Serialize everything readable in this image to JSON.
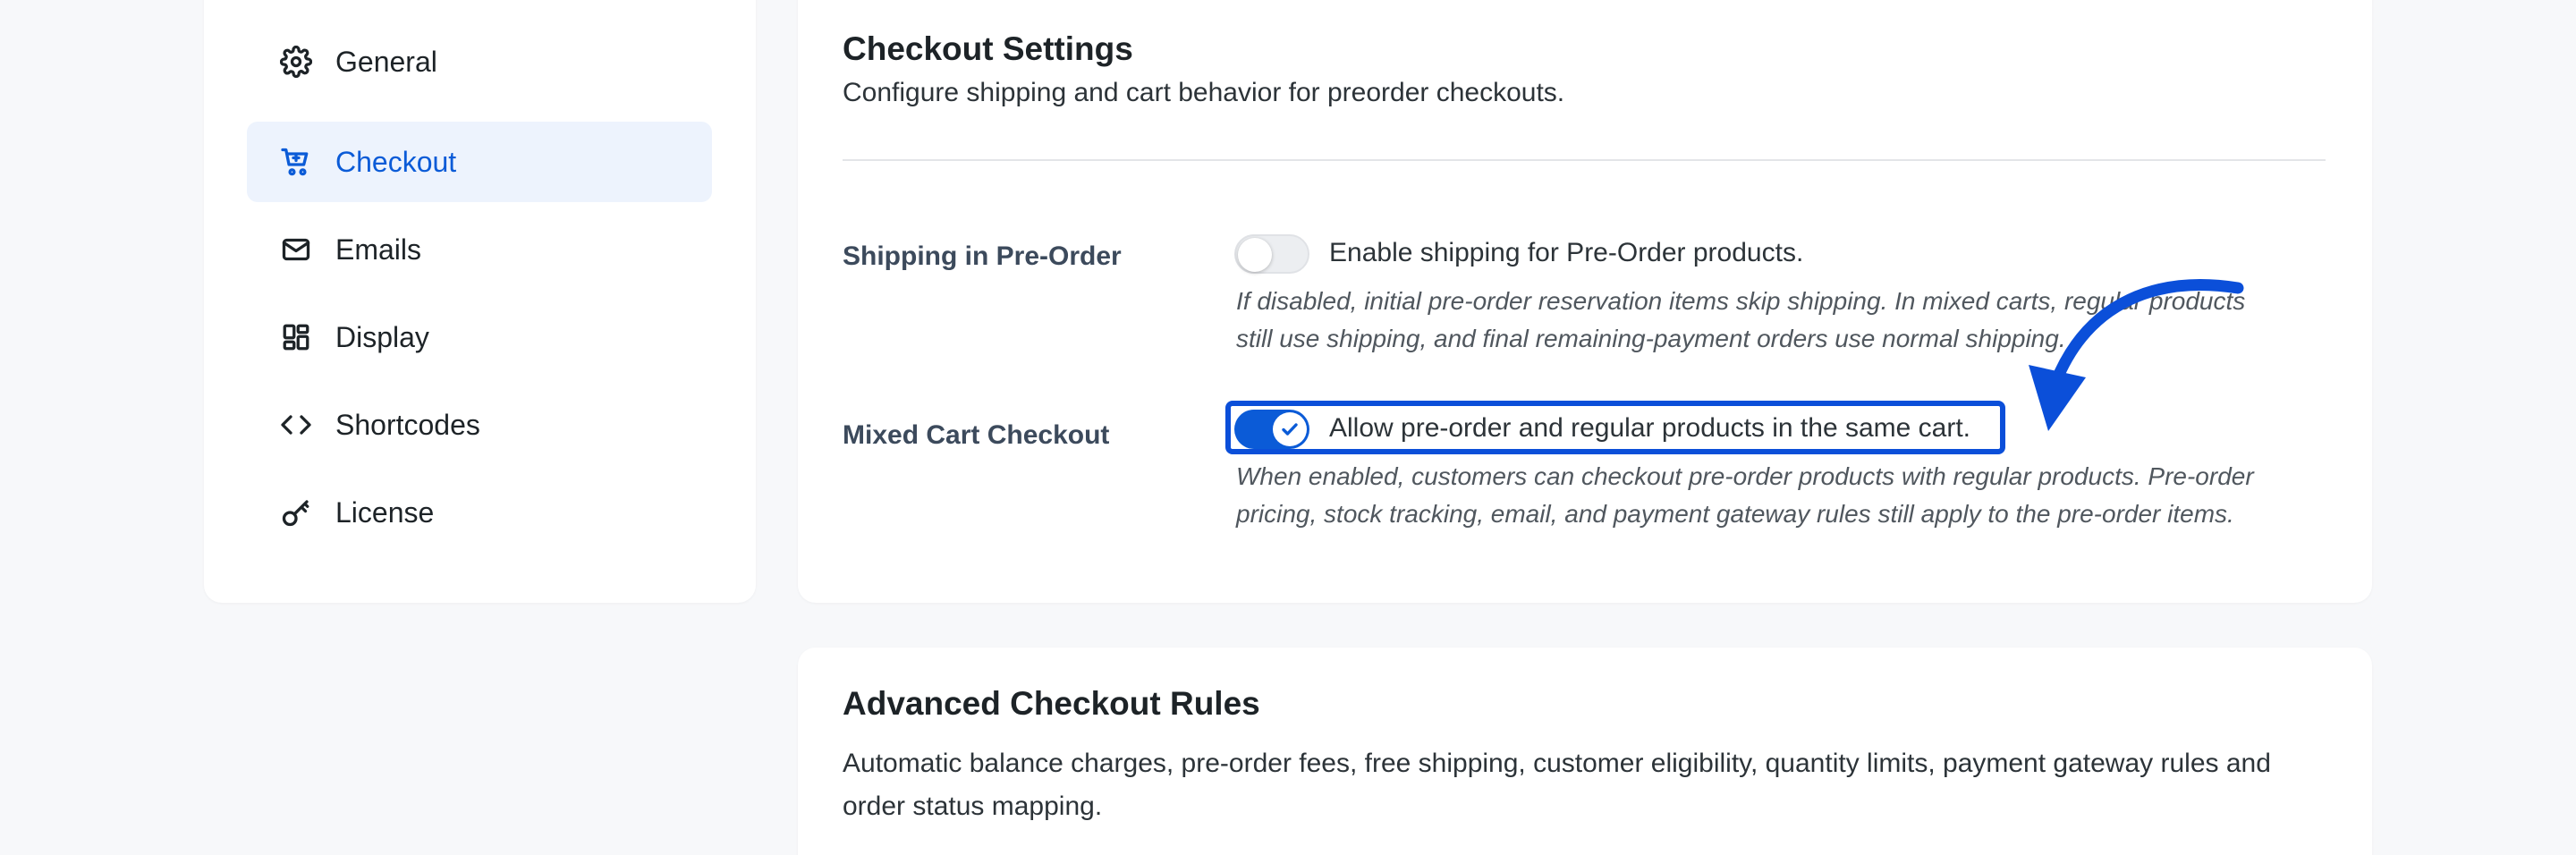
{
  "sidebar": {
    "items": [
      {
        "label": "General",
        "icon": "gear-icon"
      },
      {
        "label": "Checkout",
        "icon": "cart-icon",
        "active": true
      },
      {
        "label": "Emails",
        "icon": "mail-icon"
      },
      {
        "label": "Display",
        "icon": "dashboard-icon"
      },
      {
        "label": "Shortcodes",
        "icon": "code-icon"
      },
      {
        "label": "License",
        "icon": "key-icon"
      }
    ]
  },
  "checkout": {
    "title": "Checkout Settings",
    "description": "Configure shipping and cart behavior for preorder checkouts.",
    "shipping": {
      "label": "Shipping in Pre-Order",
      "toggle_text": "Enable shipping for Pre-Order products.",
      "enabled": false,
      "help_line1": "If disabled, initial pre-order reservation items skip shipping. In mixed carts, regular products",
      "help_line2": "still use shipping, and final remaining-payment orders use normal shipping."
    },
    "mixed_cart": {
      "label": "Mixed Cart Checkout",
      "toggle_text": "Allow pre-order and regular products in the same cart.",
      "enabled": true,
      "help_line1": "When enabled, customers can checkout pre-order products with regular products. Pre-order",
      "help_line2": "pricing, stock tracking, email, and payment gateway rules still apply to the pre-order items."
    }
  },
  "advanced": {
    "title": "Advanced Checkout Rules",
    "description_line1": "Automatic balance charges, pre-order fees, free shipping, customer eligibility, quantity limits, payment gateway rules and",
    "description_line2": "order status mapping."
  },
  "colors": {
    "accent": "#0b5bd7",
    "annotation": "#0b4fd9",
    "active_bg": "#edf3fd",
    "page_bg": "#f7f8fa"
  }
}
